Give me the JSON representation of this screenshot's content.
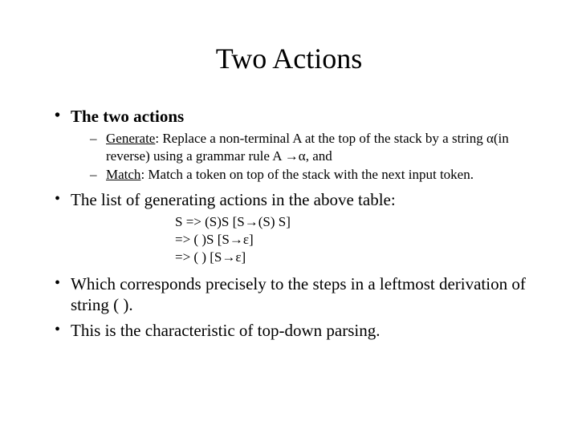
{
  "title": "Two Actions",
  "bullets": {
    "b1_head": "The two actions",
    "b1_sub1_label": "Generate",
    "b1_sub1_rest": ": Replace a non-terminal A at the top of the stack by a string α(in reverse) using a grammar rule A →α, and",
    "b1_sub2_label": "Match",
    "b1_sub2_rest": ": Match a token on top of the stack with the next input token.",
    "b2": "The list of generating actions in the above table:",
    "deriv_l1": "S => (S)S   [S→(S) S]",
    "deriv_l2": "   => ( )S   [S→ε]",
    "deriv_l3": "   => ( )    [S→ε]",
    "b3": "Which corresponds precisely to the steps in a leftmost derivation of string ( ).",
    "b4": "This is the characteristic of top-down parsing."
  }
}
